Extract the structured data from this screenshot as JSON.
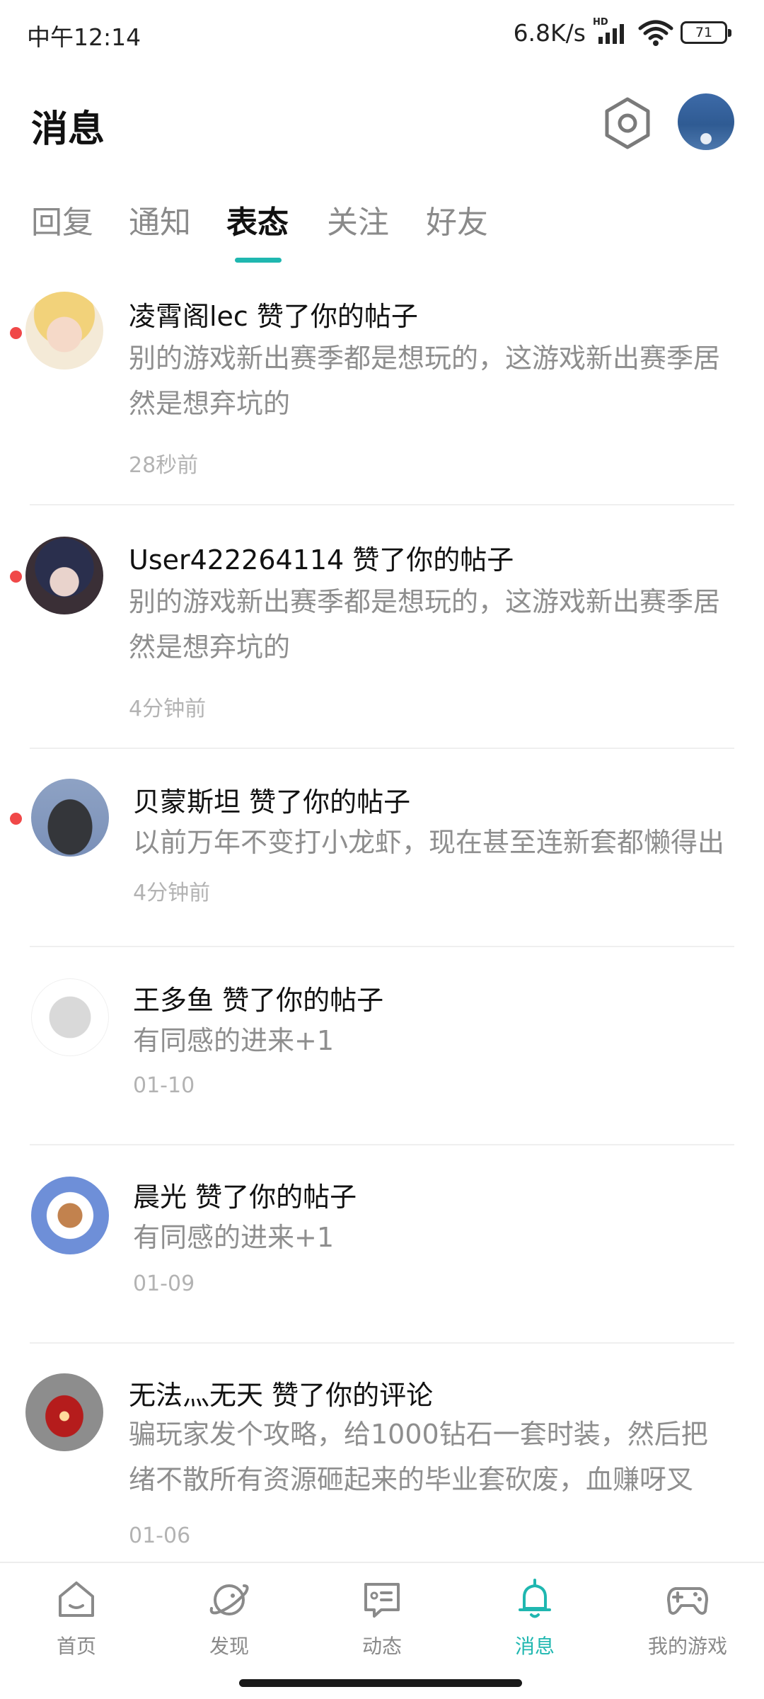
{
  "status_bar": {
    "time": "中午12:14",
    "net_speed": "6.8K/s",
    "network_badge": "HD",
    "battery": "71",
    "icons": [
      "signal-icon",
      "wifi-icon",
      "battery-icon"
    ]
  },
  "header": {
    "title": "消息",
    "settings_icon": "hexagon-gear-icon",
    "avatar_icon": "user-avatar"
  },
  "tabs": [
    {
      "label": "回复",
      "active": false
    },
    {
      "label": "通知",
      "active": false
    },
    {
      "label": "表态",
      "active": true
    },
    {
      "label": "关注",
      "active": false
    },
    {
      "label": "好友",
      "active": false
    }
  ],
  "accent_color": "#1fb7b0",
  "unread_color": "#f04848",
  "notifications": [
    {
      "who": "凌霄阁lec 赞了你的帖子",
      "body": "别的游戏新出赛季都是想玩的，这游戏新出赛季居然是想弃坑的",
      "time": "28秒前",
      "unread": true
    },
    {
      "who": "User422264114 赞了你的帖子",
      "body": "别的游戏新出赛季都是想玩的，这游戏新出赛季居然是想弃坑的",
      "time": "4分钟前",
      "unread": true
    },
    {
      "who": "贝蒙斯坦 赞了你的帖子",
      "body": "以前万年不变打小龙虾，现在甚至连新套都懒得出",
      "time": "4分钟前",
      "unread": true
    },
    {
      "who": "王多鱼 赞了你的帖子",
      "body": "有同感的进来+1",
      "time": "01-10",
      "unread": false
    },
    {
      "who": "晨光 赞了你的帖子",
      "body": "有同感的进来+1",
      "time": "01-09",
      "unread": false
    },
    {
      "who": "无法灬无天 赞了你的评论",
      "body": "骗玩家发个攻略，给1000钻石一套时装，然后把绪不散所有资源砸起来的毕业套砍废，血赚呀叉总…",
      "time": "01-06",
      "unread": false
    }
  ],
  "bottom_nav": [
    {
      "label": "首页",
      "icon": "home-icon",
      "active": false
    },
    {
      "label": "发现",
      "icon": "planet-icon",
      "active": false
    },
    {
      "label": "动态",
      "icon": "chat-icon",
      "active": false
    },
    {
      "label": "消息",
      "icon": "bell-icon",
      "active": true
    },
    {
      "label": "我的游戏",
      "icon": "gamepad-icon",
      "active": false
    }
  ]
}
